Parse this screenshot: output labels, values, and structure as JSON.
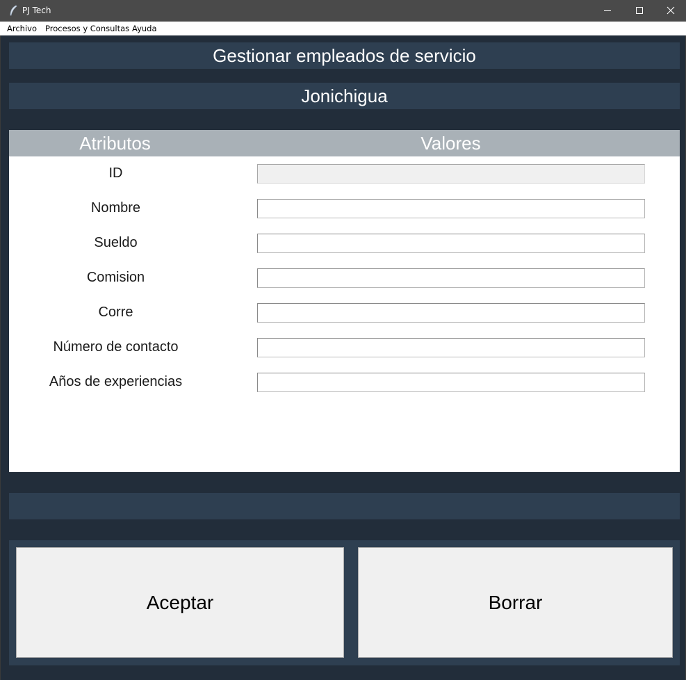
{
  "window": {
    "title": "PJ Tech"
  },
  "menu": {
    "items": [
      "Archivo",
      "Procesos y Consultas",
      "Ayuda"
    ]
  },
  "header": {
    "title": "Gestionar empleados de servicio",
    "subtitle": "Jonichigua"
  },
  "form": {
    "columns": {
      "attributes": "Atributos",
      "values": "Valores"
    },
    "fields": [
      {
        "label": "ID",
        "value": "",
        "readonly": true
      },
      {
        "label": "Nombre",
        "value": ""
      },
      {
        "label": "Sueldo",
        "value": ""
      },
      {
        "label": "Comision",
        "value": ""
      },
      {
        "label": "Corre",
        "value": ""
      },
      {
        "label": "Número de contacto",
        "value": ""
      },
      {
        "label": "Años de experiencias",
        "value": ""
      }
    ]
  },
  "actions": {
    "accept": "Aceptar",
    "clear": "Borrar"
  },
  "colors": {
    "background": "#222d3a",
    "band": "#2e3f51",
    "table_header": "#a9b1b7",
    "button": "#f0f0f0"
  },
  "icons": {
    "app": "feather-icon",
    "minimize": "minimize-icon",
    "maximize": "maximize-icon",
    "close": "close-icon"
  }
}
